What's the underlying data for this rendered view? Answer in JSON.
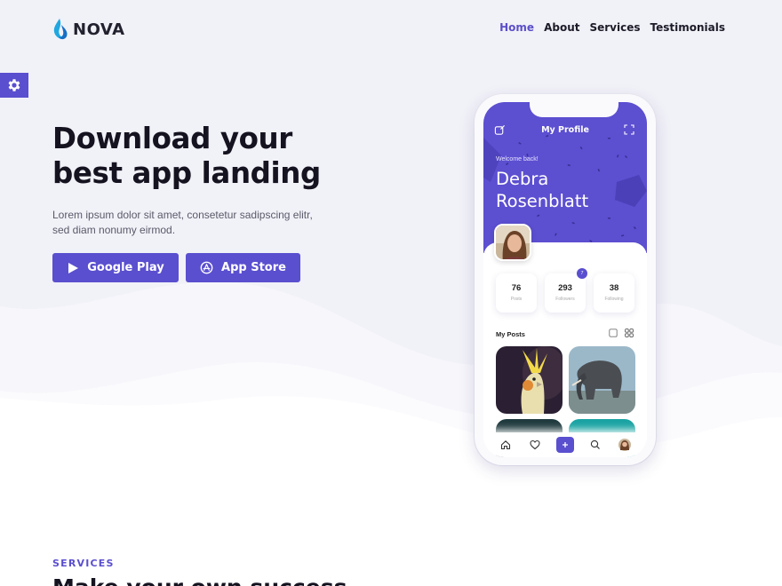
{
  "brand": {
    "name": "NOVA",
    "accent": "#5a4fcf"
  },
  "nav": {
    "links": [
      {
        "label": "Home",
        "active": true
      },
      {
        "label": "About",
        "active": false
      },
      {
        "label": "Services",
        "active": false
      },
      {
        "label": "Testimonials",
        "active": false
      }
    ]
  },
  "settings": {
    "icon": "gear-icon"
  },
  "hero": {
    "title_line1": "Download your",
    "title_line2": "best app landing",
    "subtitle": "Lorem ipsum dolor sit amet, consetetur sadipscing elitr, sed diam nonumy eirmod.",
    "buttons": {
      "google_play": "Google Play",
      "app_store": "App Store"
    }
  },
  "phone": {
    "header_title": "My Profile",
    "welcome": "Welcome back!",
    "name_line1": "Debra",
    "name_line2": "Rosenblatt",
    "stats": [
      {
        "value": "76",
        "label": "Posts"
      },
      {
        "value": "293",
        "label": "Followers",
        "badge": "7"
      },
      {
        "value": "38",
        "label": "Following"
      }
    ],
    "posts_title": "My Posts",
    "bottom_nav": [
      "home-icon",
      "heart-icon",
      "plus-icon",
      "search-icon",
      "avatar"
    ]
  },
  "services": {
    "label": "SERVICES",
    "title": "Make your own success"
  }
}
